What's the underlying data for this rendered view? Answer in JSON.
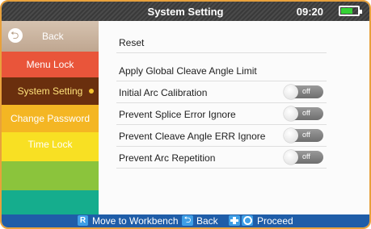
{
  "header": {
    "title": "System Setting",
    "time": "09:20",
    "battery_icon": "battery-icon",
    "battery_level": 0.7
  },
  "sidebar": {
    "back_label": "Back",
    "back_icon": "back-arrow-icon",
    "items": [
      {
        "label": "Menu Lock",
        "color": "#e9553a"
      },
      {
        "label": "System Setting",
        "color": "#6a2f0e",
        "selected": true
      },
      {
        "label": "Change Password",
        "color": "#f4b623"
      },
      {
        "label": "Time Lock",
        "color": "#f8e023"
      }
    ]
  },
  "main": {
    "rows": [
      {
        "label": "Reset"
      },
      {
        "label": "Apply Global Cleave Angle Limit"
      },
      {
        "label": "Initial Arc Calibration",
        "toggle": "off"
      },
      {
        "label": "Prevent Splice Error Ignore",
        "toggle": "off"
      },
      {
        "label": "Prevent Cleave Angle ERR Ignore",
        "toggle": "off"
      },
      {
        "label": "Prevent Arc Repetition",
        "toggle": "off"
      }
    ]
  },
  "footer": {
    "r_key": "R",
    "move_label": "Move to Workbench",
    "back_label": "Back",
    "proceed_label": "Proceed"
  },
  "colors": {
    "frame": "#e8a13c",
    "footer": "#1f5da8",
    "key": "#3f9fe6"
  }
}
